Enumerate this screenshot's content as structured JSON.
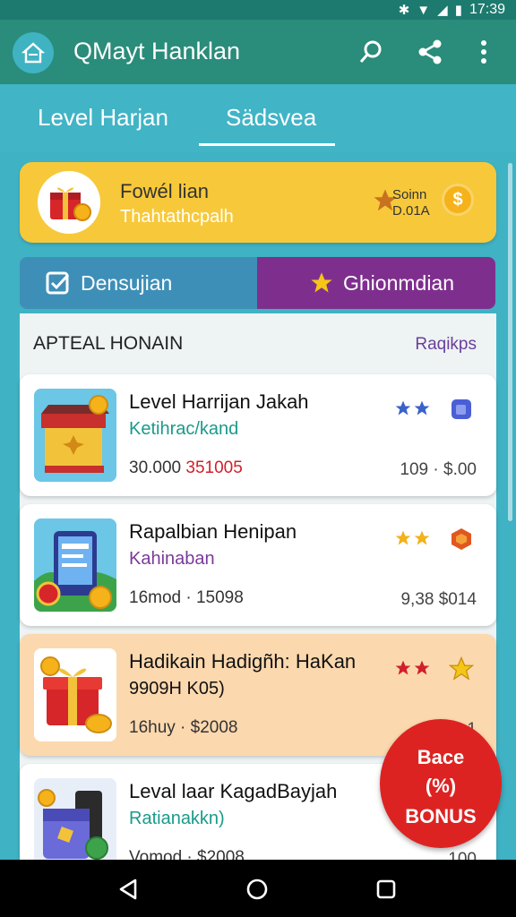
{
  "status_bar": {
    "time": "17:39"
  },
  "app_bar": {
    "title": "QMayt Hanklan",
    "icons": [
      "home-icon",
      "search-icon",
      "share-icon",
      "more-vert-icon"
    ]
  },
  "tabs": [
    {
      "label": "Level Harjan",
      "active": false
    },
    {
      "label": "Sädsvea",
      "active": true
    }
  ],
  "promo": {
    "title": "Fowél lian",
    "subtitle": "Thahtathcpalh",
    "coin_label_line1": "Soinn",
    "coin_label_line2": "D.01A",
    "coin_symbol": "$"
  },
  "segments": {
    "left_label": "Densujian",
    "right_label": "Ghionmdian"
  },
  "section": {
    "title": "APTEAL HONAIN",
    "link": "Raqikps"
  },
  "listings": [
    {
      "name": "Level Harrijan Jakah",
      "subtitle": "Ketihrac/kand",
      "subtitle_color": "#1a9a8a",
      "meta_a": "30.000",
      "meta_b": "351005",
      "right": "109 · $.00",
      "star_color": "#3a63c8"
    },
    {
      "name": "Rapalbian Henipan",
      "subtitle": "Kahinaban",
      "subtitle_color": "#7a3a9a",
      "meta_a": "16mod · 15098",
      "meta_b": "",
      "right": "9,38  $014",
      "star_color": "#f2b21c"
    },
    {
      "name": "Hadikain Hadigñh: HaKan",
      "subtitle": "9909H K05)",
      "subtitle_color": "#111111",
      "meta_a": "16huy · $2008",
      "meta_b": "",
      "right": "1",
      "star_color": "#d0202a"
    },
    {
      "name": "Leval laar KagadBayjah",
      "subtitle": "Ratianakkn)",
      "subtitle_color": "#1a9a8a",
      "meta_a": "Vomod · $2008",
      "meta_b": "",
      "right": "100",
      "star_color": "#f2b21c"
    }
  ],
  "fab": {
    "line1": "Bace",
    "line2": "(%)",
    "line3": "BONUS"
  },
  "colors": {
    "header": "#2a8c7a",
    "background": "#3fb2c4",
    "promo": "#f7c93a",
    "segment_left": "#3e8fb8",
    "segment_right": "#7e2f8e",
    "accent_red": "#dd2322"
  }
}
